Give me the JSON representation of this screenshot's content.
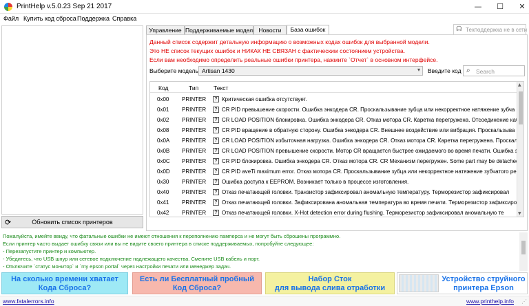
{
  "window": {
    "title": "PrintHelp v.5.0.23 Sep 21 2017",
    "min_glyph": "—",
    "max_glyph": "☐",
    "close_glyph": "✕"
  },
  "menu": [
    "Файл",
    "Купить код сброса",
    "Поддержка",
    "Справка"
  ],
  "left_panel": {
    "refresh_label": "Обновить список принтеров",
    "refresh_icon": "refresh-icon"
  },
  "tabs": [
    "Управление",
    "Поддерживаемые модели",
    "Новости",
    "База ошибок"
  ],
  "active_tab": "База ошибок",
  "support_button": {
    "label": "Техподдержка не в сети",
    "icon": "headset-icon"
  },
  "warning_lines": [
    "Данный список содержит детальную информацию о возможных кодах ошибок для выбранной модели.",
    "Это НЕ список текущих ошибок и НИКАК НЕ СВЯЗАН с фактическим состоянием устройства.",
    "Если вам необходимо определить реальные ошибки принтера, нажмите `Отчет` в основном интерфейсе."
  ],
  "model": {
    "label": "Выберите модель",
    "selected": "Artisan 1430",
    "code_label": "Введите код",
    "search_placeholder": "Search"
  },
  "table": {
    "headers": [
      "Код",
      "Тип",
      "Текст"
    ],
    "rows": [
      {
        "code": "0x00",
        "type": "PRINTER",
        "text": "Критическая ошибка отсутствует."
      },
      {
        "code": "0x01",
        "type": "PRINTER",
        "text": "CR PID превышение скорости. Ошибка энкодера CR. Проскальзывание зубца или некорректное натяжение зубча"
      },
      {
        "code": "0x02",
        "type": "PRINTER",
        "text": "CR LOAD POSITION блокировка. Ошибка энкодера CR. Отказ мотора CR. Каретка перегружена. Отсоединение каб"
      },
      {
        "code": "0x08",
        "type": "PRINTER",
        "text": "CR PID вращение в обратную сторону. Ошибка энкодера CR. Внешнее воздействие или вибрация. Проскальзыва"
      },
      {
        "code": "0x0A",
        "type": "PRINTER",
        "text": "CR LOAD POSITION избыточная нагрузка. Ошибка энкодера CR. Отказ мотора CR. Каретка перегружена. Проскальз"
      },
      {
        "code": "0x0B",
        "type": "PRINTER",
        "text": "CR LOAD POSITION превышение скорости. Мотор CR вращается быстрее ожидаемого во время печати. Ошибка э"
      },
      {
        "code": "0x0C",
        "type": "PRINTER",
        "text": "CR PID блокировка. Ошибка энкодера CR. Отказ мотора CR. CR Механизм перегружен. Some part may be detached"
      },
      {
        "code": "0x0D",
        "type": "PRINTER",
        "text": "CR PID aveTi maximum error. Отказ мотора CR. Проскальзывание зубца или некорректное натяжение зубчатого ре"
      },
      {
        "code": "0x30",
        "type": "PRINTER",
        "text": "Ошибка доступа к EEPROM. Возникает только в процессе изготовления."
      },
      {
        "code": "0x40",
        "type": "PRINTER",
        "text": "Отказ печатающей головки. Транзистор зафиксировал аномальную температуру. Терморезистор зафиксировал"
      },
      {
        "code": "0x41",
        "type": "PRINTER",
        "text": "Отказ печатающей головки. Зафиксирована аномальная температура во время печати. Терморезистор зафиксиро"
      },
      {
        "code": "0x42",
        "type": "PRINTER",
        "text": "Отказ печатающей головки. X-Hot detection error during flushing. Терморезистор зафиксировал аномальную те"
      }
    ],
    "row_icon": "help-icon"
  },
  "info": {
    "lines": [
      {
        "text": "Пожалуйста, имейте ввиду, что фатальные ошибки не имеют отношения к переполнению памперса и не могут быть сброшены программно.",
        "color": "#1a8a1a"
      },
      {
        "text": "Если принтер часто выдает ошибку связи или вы не видите своего принтера в списке поддерживаемых, попробуйте следующее:",
        "color": "#1a8a1a"
      },
      {
        "text": "- Перезапустите принтер и компьютер.",
        "color": "#1a8a1a"
      },
      {
        "text": "- Убедитесь, что USB шнур или сетевое подключение надлежащего качества. Смените USB кабель и порт.",
        "color": "#1a8a1a"
      },
      {
        "text": "- Отключите `статус монитор` и `my epson portal` через настройки печати или менеджер задач.",
        "color": "#1a8a1a"
      }
    ]
  },
  "banners": [
    {
      "line1": "На сколько времени хватает",
      "line2": "Кода Сброса?"
    },
    {
      "line1": "Есть ли Бесплатный пробный",
      "line2": "Код Сброса?"
    },
    {
      "line1": "Набор Сток",
      "line2": "для вывода слива отработки"
    },
    {
      "line1": "Устройство струйного",
      "line2": "принтера Epson"
    }
  ],
  "footer": {
    "left_link": "www.fatalerrors.info",
    "right_link": "www.printhelp.info",
    "grip": "⋰"
  },
  "colors": {
    "warning": "#e00000",
    "info": "#1a8a1a",
    "link": "#1a0dab",
    "banner_text": "#1a73e8"
  }
}
